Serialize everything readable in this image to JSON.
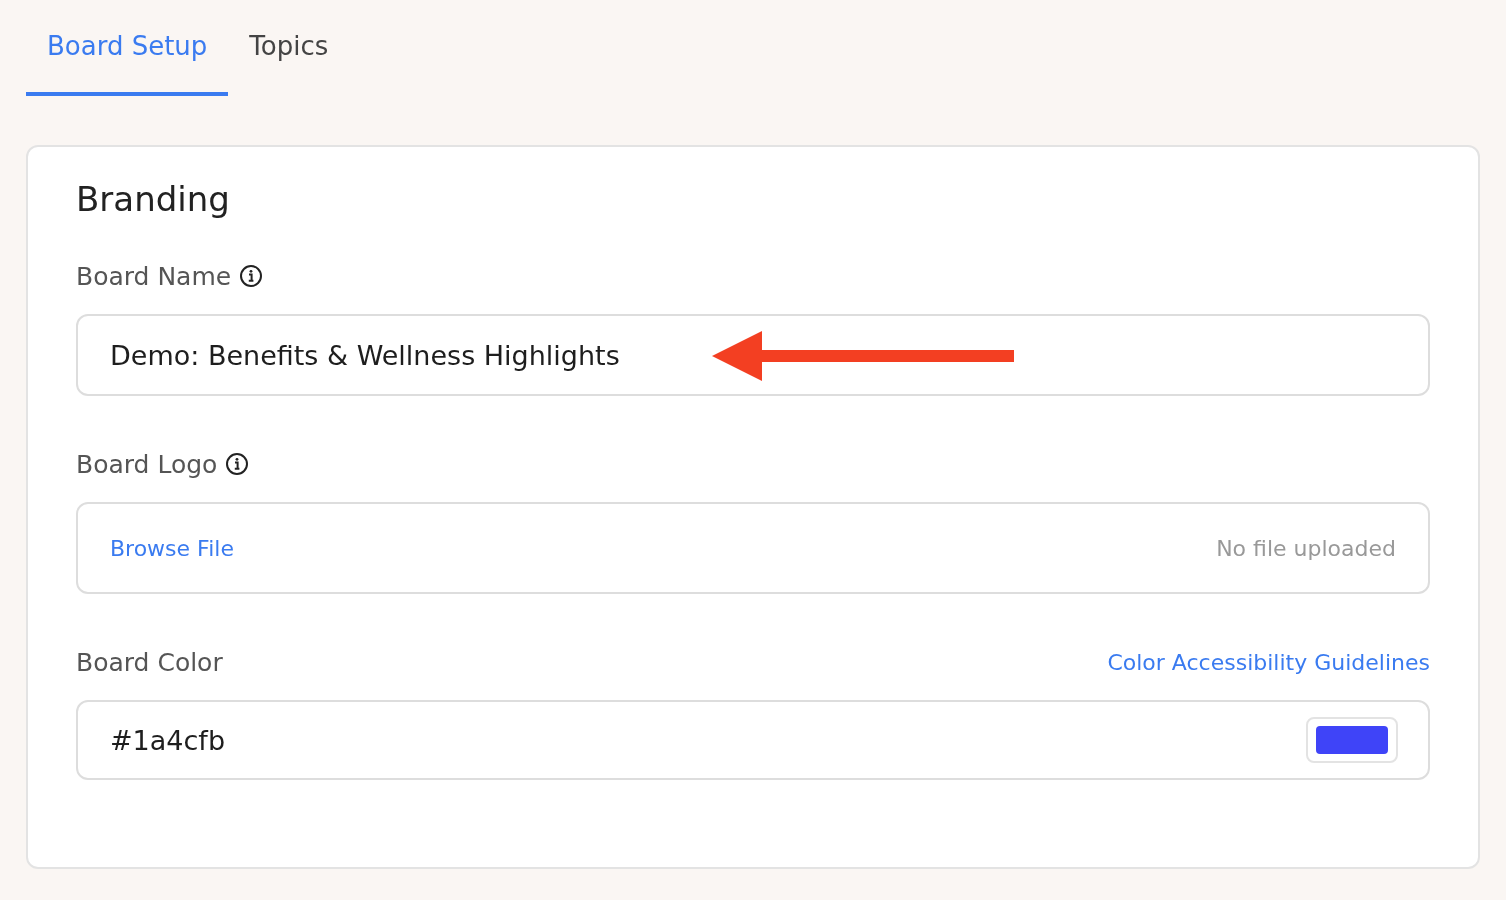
{
  "tabs": [
    {
      "label": "Board Setup",
      "selected": true
    },
    {
      "label": "Topics",
      "selected": false
    }
  ],
  "section": {
    "title": "Branding",
    "fields": [
      {
        "kind": "text",
        "label": "Board Name",
        "info": true,
        "value": "Demo: Benefits & Wellness Highlights"
      },
      {
        "kind": "file",
        "label": "Board Logo",
        "info": true,
        "action": "Browse File",
        "status": "No file uploaded"
      },
      {
        "kind": "color",
        "label": "Board Color",
        "info": false,
        "link": "Color Accessibility Guidelines",
        "value": "#1a4cfb",
        "color": "#3f44f8"
      }
    ]
  }
}
